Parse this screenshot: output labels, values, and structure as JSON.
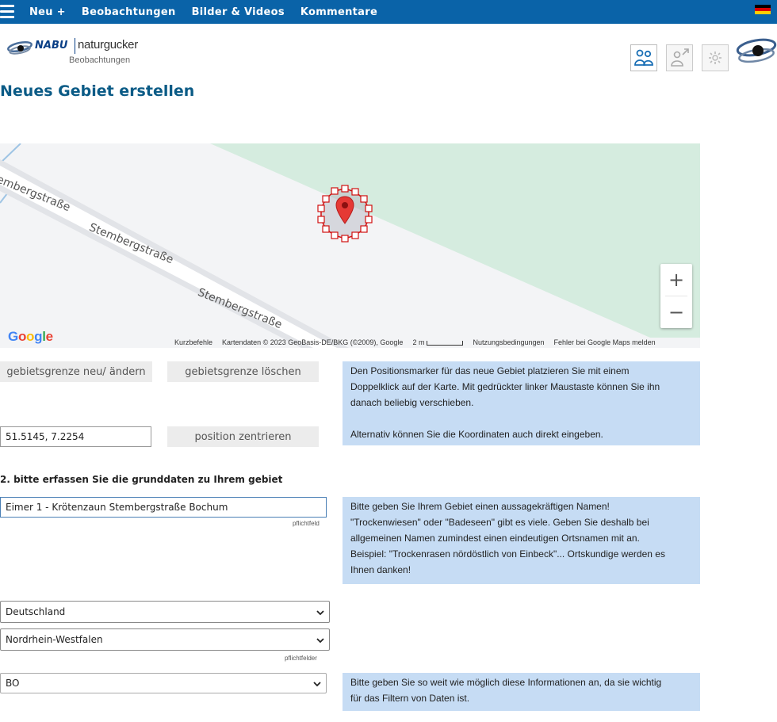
{
  "topbar": {
    "nav": [
      "Neu +",
      "Beobachtungen",
      "Bilder & Videos",
      "Kommentare"
    ],
    "flag_colors": [
      "#000000",
      "#dd0000",
      "#ffce00"
    ],
    "accent": "#0a63a8"
  },
  "logo": {
    "brand": "NABU",
    "name": "naturgucker",
    "subtitle": "Beobachtungen"
  },
  "header_icons": [
    "people-icon",
    "person-arrow-icon",
    "gear-icon",
    "eye-logo-icon"
  ],
  "page_title": "Neues Gebiet erstellen",
  "map": {
    "street_name": "Stembergstraße",
    "google_logo": "Google",
    "attribution": {
      "shortcuts": "Kurzbefehle",
      "data": "Kartendaten © 2023 GeoBasis-DE/BKG (©2009), Google",
      "scale": "2 m",
      "terms": "Nutzungsbedingungen",
      "report": "Fehler bei Google Maps melden"
    },
    "zoom_in": "+",
    "zoom_out": "−"
  },
  "buttons": {
    "boundary_edit": "gebietsgrenze neu/ ändern",
    "boundary_delete": "gebietsgrenze löschen",
    "center_position": "position zentrieren"
  },
  "coordinates_value": "51.5145, 7.2254",
  "info_marker": {
    "line1": "Den Positionsmarker für das neue Gebiet platzieren Sie mit einem",
    "line2": "Doppelklick auf der Karte. Mit gedrückter linker Maustaste können Sie ihn",
    "line3": "danach beliebig verschieben.",
    "line4": "Alternativ können Sie die Koordinaten auch direkt eingeben."
  },
  "section2_heading": "2. bitte erfassen Sie die grunddaten zu Ihrem gebiet",
  "name_field": {
    "value": "Eimer 1 - Krötenzaun Stembergstraße Bochum",
    "required_label": "pflichtfeld"
  },
  "info_name": {
    "line1": "Bitte geben Sie Ihrem Gebiet einen aussagekräftigen Namen!",
    "line2": "\"Trockenwiesen\" oder \"Badeseen\" gibt es viele. Geben Sie deshalb bei",
    "line3": "allgemeinen Namen zumindest einen eindeutigen Ortsnamen mit an.",
    "line4": "Beispiel: \"Trockenrasen nördöstlich von Einbeck\"... Ortskundige werden es",
    "line5": "Ihnen danken!"
  },
  "selects": {
    "country": "Deutschland",
    "state": "Nordrhein-Westfalen",
    "required_label": "pflichtfelder",
    "district": "BO"
  },
  "info_filter": {
    "line1": "Bitte geben Sie so weit wie möglich diese Informationen an, da sie wichtig",
    "line2": "für das Filtern von Daten ist."
  }
}
